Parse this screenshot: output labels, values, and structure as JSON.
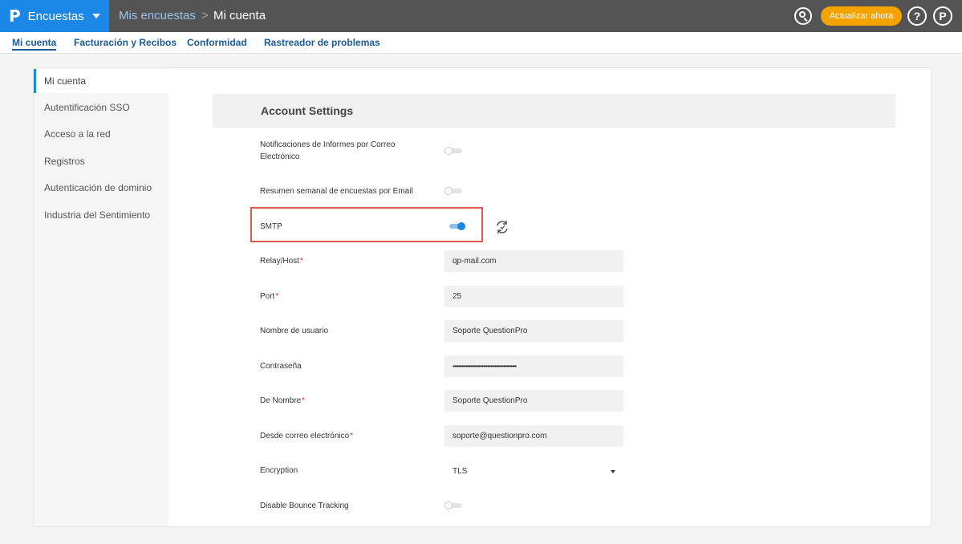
{
  "topbar": {
    "logo_glyph": "P",
    "app_name": "Encuestas",
    "breadcrumb_link": "Mis encuestas",
    "breadcrumb_sep": ">",
    "breadcrumb_current": "Mi cuenta",
    "upgrade_label": "Actualizar ahora",
    "help_glyph": "?",
    "profile_glyph": "P",
    "accent": "#1b87e6",
    "upgrade_color": "#f5a300"
  },
  "subnav": {
    "tabs": [
      {
        "label": "Mi cuenta",
        "active": true
      },
      {
        "label": "Facturación y Recibos"
      },
      {
        "label": "Conformidad"
      },
      {
        "label": "Rastreador de problemas"
      }
    ]
  },
  "sidebar": {
    "items": [
      {
        "label": "Mi cuenta",
        "active": true
      },
      {
        "label": "Autentificación SSO"
      },
      {
        "label": "Acceso a la red"
      },
      {
        "label": "Registros"
      },
      {
        "label": "Autenticación de dominio"
      },
      {
        "label": "Industria del Sentimiento"
      }
    ]
  },
  "settings": {
    "title": "Account Settings",
    "email_notifications": {
      "label_line1": "Notificaciones de Informes por Correo",
      "label_line2": "Electrónico",
      "enabled": false
    },
    "weekly_summary": {
      "label": "Resumen semanal de encuestas por Email",
      "enabled": false
    },
    "smtp": {
      "label": "SMTP",
      "enabled": true
    },
    "relay_host": {
      "label": "Relay/Host",
      "value": "qp-mail.com",
      "required": "*"
    },
    "port": {
      "label": "Port",
      "value": "25",
      "required": "*"
    },
    "username": {
      "label": "Nombre de usuario",
      "value": "Soporte QuestionPro"
    },
    "password": {
      "label": "Contraseña",
      "value": "••••••••••••••••••••••••••••••••••••••••••••"
    },
    "from_name": {
      "label": "De Nombre",
      "value": "Soporte QuestionPro",
      "required": "*"
    },
    "from_email": {
      "label": "Desde correo electrónico",
      "value": "soporte@questionpro.com",
      "required": "*"
    },
    "encryption": {
      "label": "Encryption",
      "value": "TLS"
    },
    "bounce_tracking": {
      "label": "Disable Bounce Tracking",
      "enabled": false
    }
  }
}
